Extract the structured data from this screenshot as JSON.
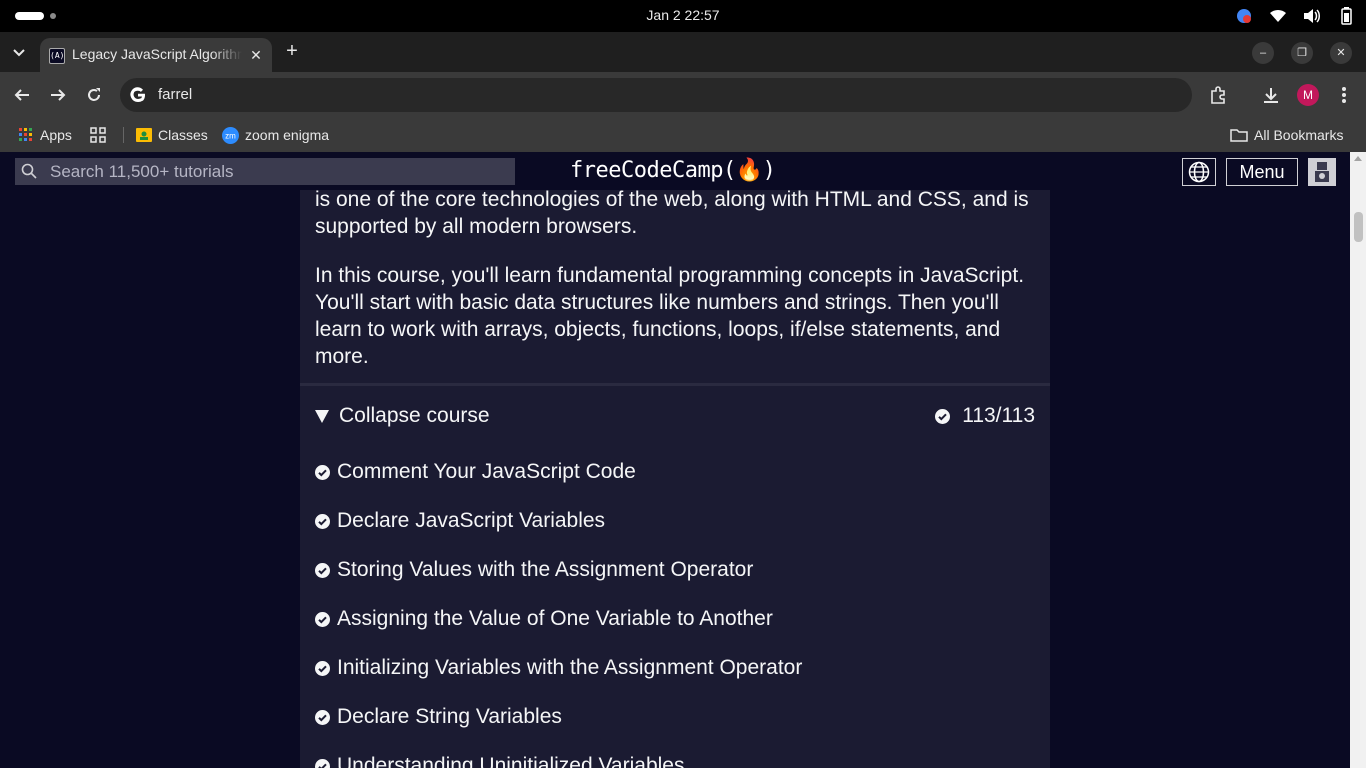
{
  "os": {
    "clock": "Jan 2  22:57"
  },
  "browser": {
    "tab_title": "Legacy JavaScript Algorithms",
    "tab_favicon": "(A)",
    "address": "farrel",
    "profile_initial": "M",
    "bookmarks": [
      {
        "label": "Apps",
        "icon": "apps-grid-icon"
      },
      {
        "label": "Classes",
        "icon": "classroom-icon"
      },
      {
        "label": "zoom enigma",
        "icon": "zoom-icon"
      }
    ],
    "all_bookmarks": "All Bookmarks"
  },
  "fcc": {
    "search_placeholder": "Search 11,500+ tutorials",
    "logo": "freeCodeCamp(🔥)",
    "menu_label": "Menu"
  },
  "content": {
    "intro_tail": "is one of the core technologies of the web, along with HTML and CSS, and is supported by all modern browsers.",
    "intro_body": "In this course, you'll learn fundamental programming concepts in JavaScript. You'll start with basic data structures like numbers and strings. Then you'll learn to work with arrays, objects, functions, loops, if/else statements, and more.",
    "collapse_label": "Collapse course",
    "progress": "113/113",
    "lessons": [
      "Comment Your JavaScript Code",
      "Declare JavaScript Variables",
      "Storing Values with the Assignment Operator",
      "Assigning the Value of One Variable to Another",
      "Initializing Variables with the Assignment Operator",
      "Declare String Variables",
      "Understanding Uninitialized Variables"
    ]
  }
}
